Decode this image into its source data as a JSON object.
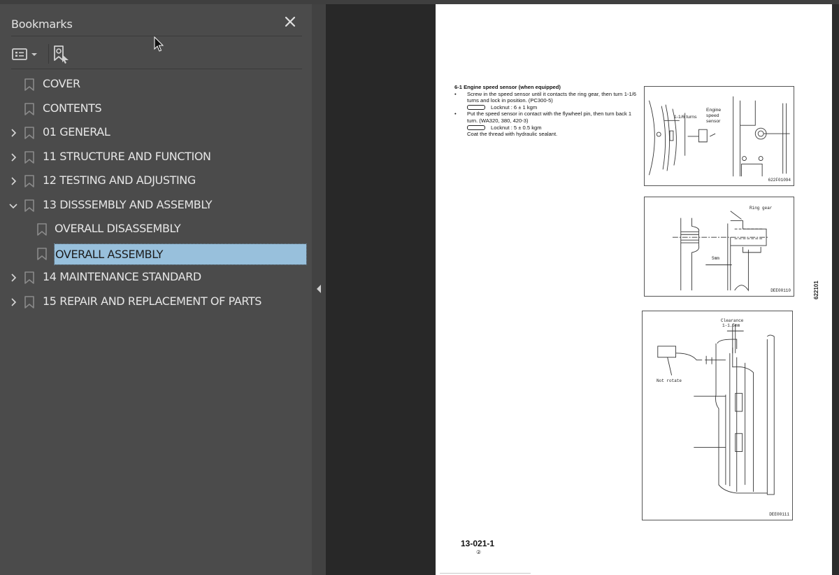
{
  "bookmarks_panel": {
    "title": "Bookmarks",
    "close_icon": "close-icon",
    "toolbar": {
      "options_icon": "list-options-icon",
      "options_dropdown_icon": "caret-down-icon",
      "find_current_icon": "find-current-bookmark-icon"
    },
    "items": [
      {
        "label": "COVER",
        "level": 0,
        "expander": "none"
      },
      {
        "label": "CONTENTS",
        "level": 0,
        "expander": "none"
      },
      {
        "label": "01 GENERAL",
        "level": 0,
        "expander": "collapsed"
      },
      {
        "label": "11 STRUCTURE AND FUNCTION",
        "level": 0,
        "expander": "collapsed"
      },
      {
        "label": "12 TESTING AND ADJUSTING",
        "level": 0,
        "expander": "collapsed"
      },
      {
        "label": "13 DISSSEMBLY AND ASSEMBLY",
        "level": 0,
        "expander": "expanded"
      },
      {
        "label": "OVERALL DISASSEMBLY",
        "level": 1,
        "expander": "none"
      },
      {
        "label": "OVERALL ASSEMBLY",
        "level": 1,
        "expander": "none",
        "selected": true
      },
      {
        "label": "14 MAINTENANCE STANDARD",
        "level": 0,
        "expander": "collapsed"
      },
      {
        "label": "15 REPAIR AND REPLACEMENT OF PARTS",
        "level": 0,
        "expander": "collapsed"
      }
    ]
  },
  "splitter": {
    "collapse_icon": "collapse-panel-left-icon"
  },
  "document_page": {
    "section_heading": "6-1 Engine speed sensor (when equipped)",
    "bullets": [
      {
        "text": "Screw in the speed sensor until it contacts the ring gear, then turn 1-1/6 turns and lock in position. (PC300-5)",
        "torque_label": "Locknut : 6 ± 1 kgm"
      },
      {
        "text": "Put the speed sensor in contact with the flywheel pin, then turn back 1 turn. (WA320, 380, 420-3)",
        "torque_label": "Locknut : 5 ± 0.5 kgm",
        "note": "Coat the thread with hydraulic sealant."
      }
    ],
    "torque_icon_label": "kgm",
    "figures": [
      {
        "code": "622F01094",
        "labels": [
          "1-1/6 turns",
          "Engine",
          "speed",
          "sensor"
        ]
      },
      {
        "code": "DEE00110",
        "labels": [
          "Ring gear",
          "5mm"
        ]
      },
      {
        "code": "DEE00111",
        "labels": [
          "Clearance",
          "1-1.5mm",
          "Not rotate"
        ]
      }
    ],
    "side_code": "622101",
    "page_number": "13-021-1",
    "revision_mark": "②"
  },
  "colors": {
    "panel_bg": "#4b4b4b",
    "viewer_bg": "#282828",
    "selection_bg": "#98c0dc",
    "text": "#e6e6e6"
  }
}
